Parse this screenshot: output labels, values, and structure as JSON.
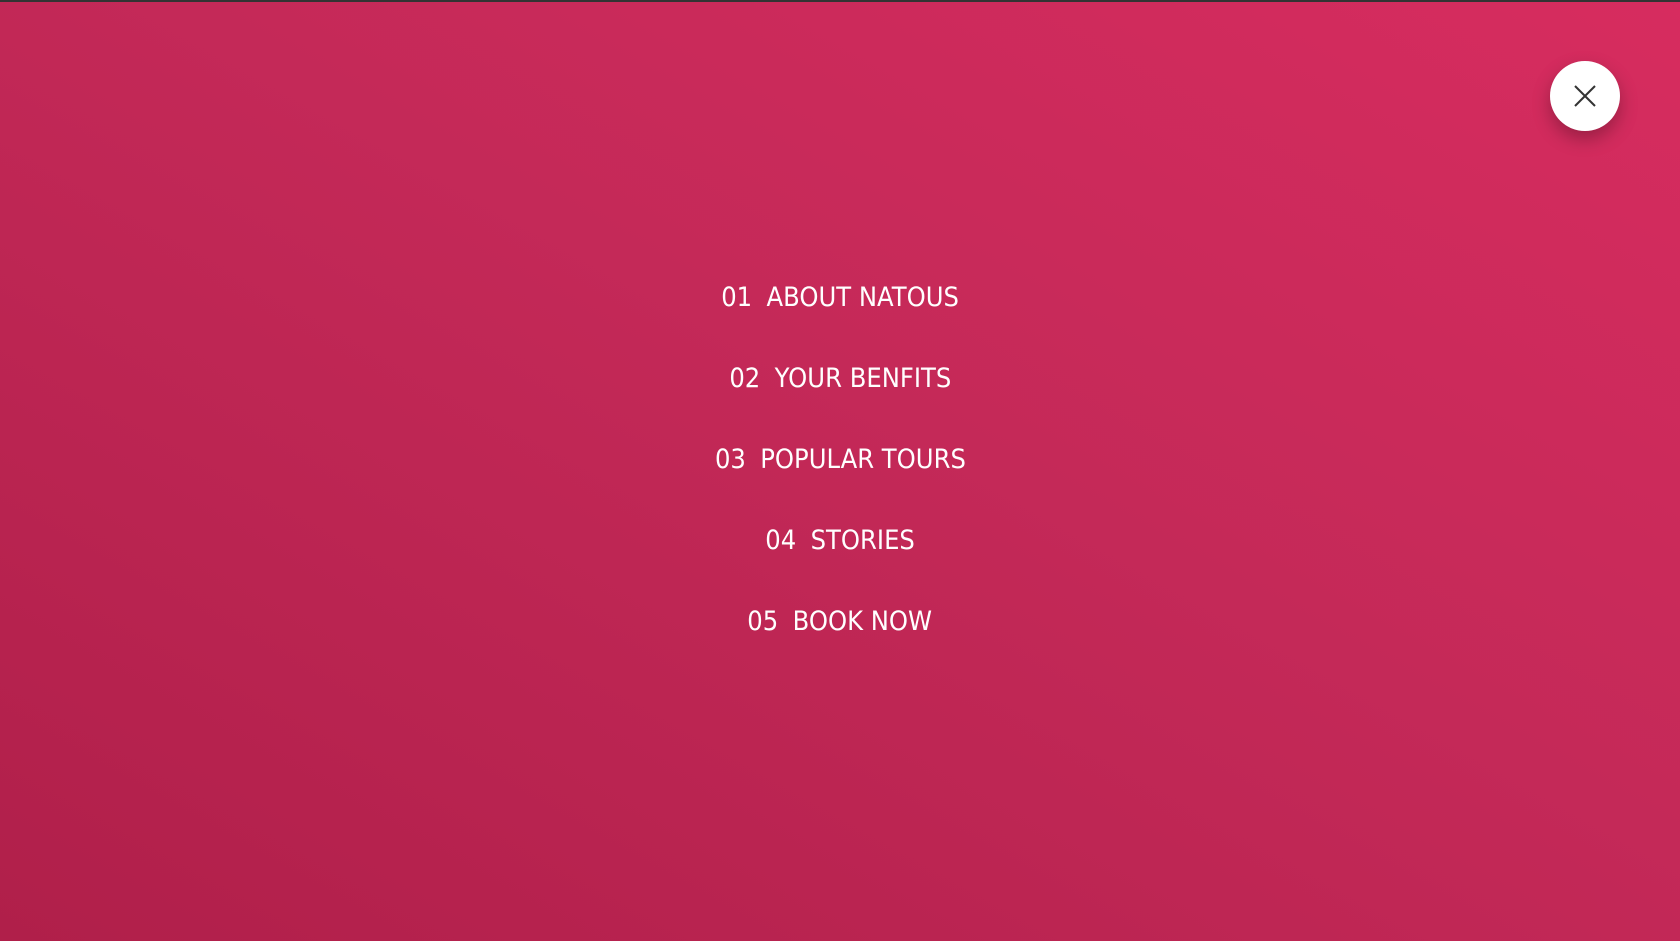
{
  "menu": {
    "close_icon": "close-icon",
    "items": [
      {
        "number": "01",
        "label": "ABOUT NATOUS"
      },
      {
        "number": "02",
        "label": "YOUR BENFITS"
      },
      {
        "number": "03",
        "label": "POPULAR TOURS"
      },
      {
        "number": "04",
        "label": "STORIES"
      },
      {
        "number": "05",
        "label": "BOOK NOW"
      }
    ]
  },
  "colors": {
    "background_start": "#b01f4a",
    "background_end": "#d72c5f",
    "text": "#ffffff",
    "close_button": "#ffffff",
    "close_icon": "#333333"
  }
}
